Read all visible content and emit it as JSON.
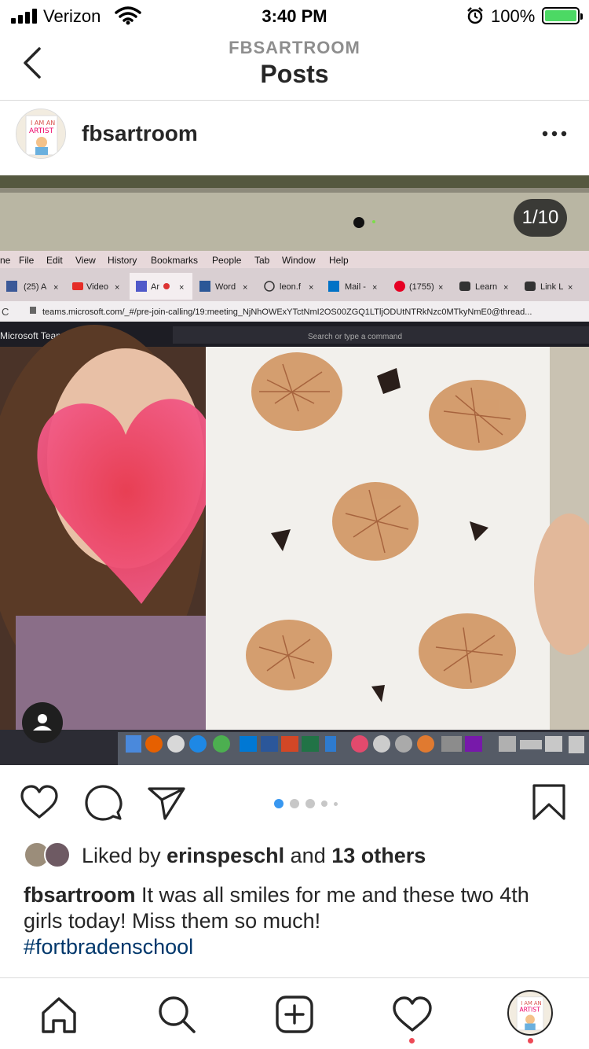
{
  "status_bar": {
    "carrier": "Verizon",
    "time": "3:40 PM",
    "battery": "100%",
    "icons": [
      "signal-icon",
      "wifi-icon",
      "alarm-icon",
      "battery-charging-icon"
    ]
  },
  "header": {
    "account": "FBSARTROOM",
    "title": "Posts"
  },
  "post": {
    "username": "fbsartroom",
    "counter": "1/10",
    "carousel_dots": 5,
    "carousel_active": 1,
    "liked_by_prefix": "Liked by ",
    "liked_by_user": "erinspeschl",
    "liked_by_mid": " and ",
    "liked_by_others": "13 others",
    "caption_user": "fbsartroom",
    "caption_text": " It was all smiles for me and these two 4th girls today!  Miss them so much!",
    "hashtag": "#fortbradenschool"
  },
  "photo": {
    "menu_bar": [
      "ne",
      "File",
      "Edit",
      "View",
      "History",
      "Bookmarks",
      "People",
      "Tab",
      "Window",
      "Help"
    ],
    "browser_tabs": [
      "(25) A",
      "Video",
      "Ar",
      "Word",
      "leon.f",
      "Mail -",
      "(1755)",
      "Learn",
      "Link L"
    ],
    "url": "teams.microsoft.com/_#/pre-join-calling/19:meeting_NjNhOWExYTctNmI2OS00ZGQ1LTljODUtNTRkNzc0MTkyNmE0@thread...",
    "app_name": "Microsoft Teams",
    "search_placeholder": "Search or type a command"
  },
  "colors": {
    "link": "#00376b",
    "active_dot": "#3897f0",
    "notification": "#ed4956",
    "battery_fill": "#4cd964"
  }
}
